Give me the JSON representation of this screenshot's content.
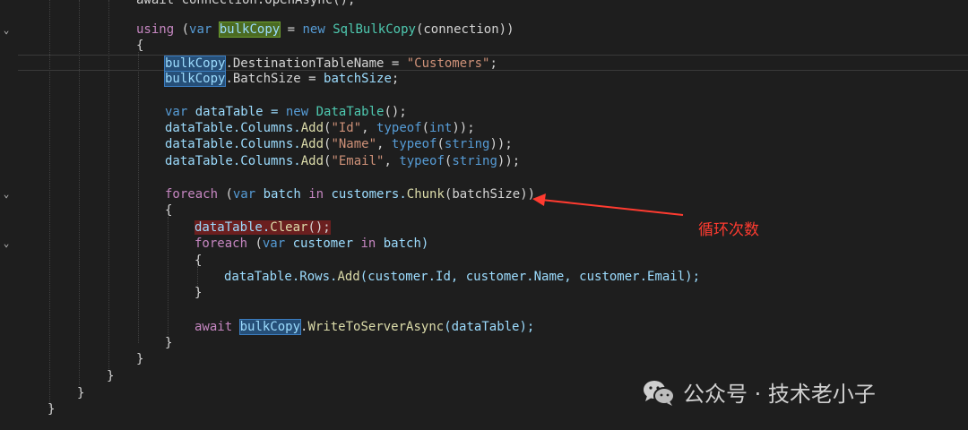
{
  "code": {
    "top_partial": "await connection.OpenAsync();",
    "l_using": {
      "kw": "using",
      "var_kw": "var",
      "name": "bulkCopy",
      "eq": " = ",
      "new_kw": "new",
      "type": "SqlBulkCopy",
      "args": "(connection))"
    },
    "brace_open": "{",
    "brace_close": "}",
    "l_dest": {
      "obj": "bulkCopy",
      "prop": ".DestinationTableName = ",
      "val": "\"Customers\"",
      "end": ";"
    },
    "l_batch": {
      "obj": "bulkCopy",
      "prop": ".BatchSize = ",
      "val": "batchSize",
      "end": ";"
    },
    "l_var_table": {
      "var_kw": "var",
      "name": " dataTable = ",
      "new_kw": "new",
      "type": "DataTable",
      "end": "();"
    },
    "l_col1": {
      "obj": "dataTable.Columns.",
      "fn": "Add",
      "open": "(",
      "str": "\"Id\"",
      "mid": ", ",
      "typeof": "typeof",
      "arg_open": "(",
      "t": "int",
      "end": "));"
    },
    "l_col2": {
      "obj": "dataTable.Columns.",
      "fn": "Add",
      "open": "(",
      "str": "\"Name\"",
      "mid": ", ",
      "typeof": "typeof",
      "arg_open": "(",
      "t": "string",
      "end": "));"
    },
    "l_col3": {
      "obj": "dataTable.Columns.",
      "fn": "Add",
      "open": "(",
      "str": "\"Email\"",
      "mid": ", ",
      "typeof": "typeof",
      "arg_open": "(",
      "t": "string",
      "end": "));"
    },
    "l_foreach1": {
      "kw": "foreach",
      "open": " (",
      "var_kw": "var",
      "name": " batch ",
      "in_kw": "in",
      "obj": " customers.",
      "fn": "Chunk",
      "args": "(batchSize))"
    },
    "l_clear": {
      "obj": "dataTable.",
      "fn": "Clear",
      "end": "();"
    },
    "l_foreach2": {
      "kw": "foreach",
      "open": " (",
      "var_kw": "var",
      "name": " customer ",
      "in_kw": "in",
      "obj": " batch)"
    },
    "l_rows": {
      "obj": "dataTable.Rows.",
      "fn": "Add",
      "args": "(customer.Id, customer.Name, customer.Email);"
    },
    "l_await": {
      "kw": "await",
      "obj": "bulkCopy",
      "dot": ".",
      "fn": "WriteToServerAsync",
      "args": "(dataTable);"
    }
  },
  "annotation": {
    "text": "循环次数",
    "color": "#ff3b30"
  },
  "watermark": {
    "text": "公众号 · 技术老小子"
  }
}
